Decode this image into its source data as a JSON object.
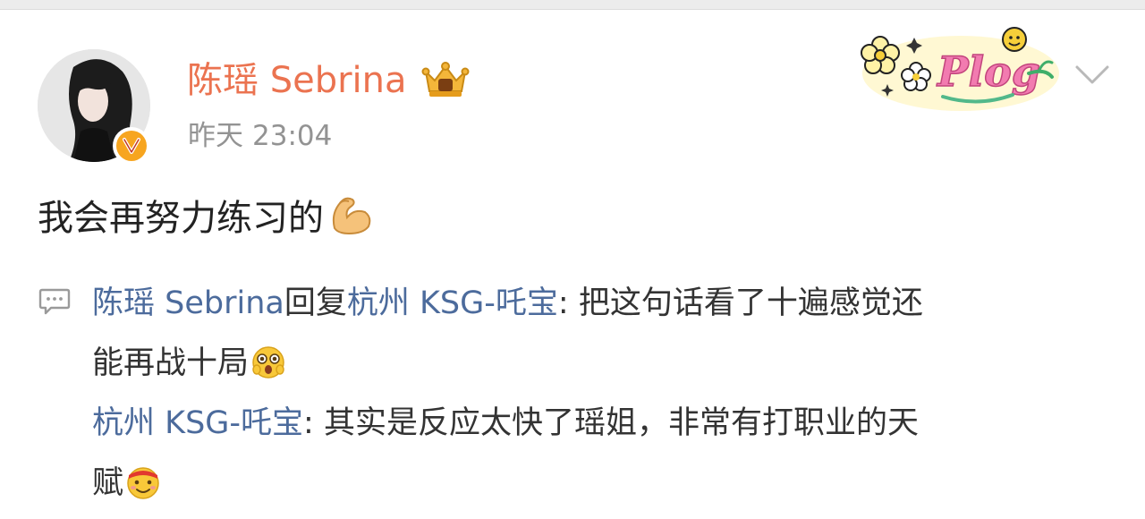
{
  "post": {
    "author": "陈瑶 Sebrina",
    "time_day": "昨天",
    "time_clock": "23:04",
    "text": "我会再努力练习的",
    "sticker_text": "Plog"
  },
  "comments": [
    {
      "author": "陈瑶 Sebrina",
      "reply_word": "回复",
      "reply_to": "杭州 KSG-吒宝",
      "line1": ": 把这句话看了十遍感觉还",
      "line2": "能再战十局",
      "emoji": "excited-face-emoji"
    },
    {
      "author": "杭州 KSG-吒宝",
      "line1": ": 其实是反应太快了瑶姐，非常有打职业的天",
      "line2": "赋",
      "emoji": "determined-face-emoji"
    }
  ],
  "icons": {
    "verified": "verified-v-icon",
    "crown": "vip-crown-icon",
    "chevron": "chevron-down-icon",
    "comment": "comment-bubble-icon",
    "muscle": "flexed-biceps-emoji"
  },
  "colors": {
    "author": "#eb7350",
    "link": "#4c6b9c",
    "muted": "#939393",
    "verified": "#f7a51f"
  }
}
